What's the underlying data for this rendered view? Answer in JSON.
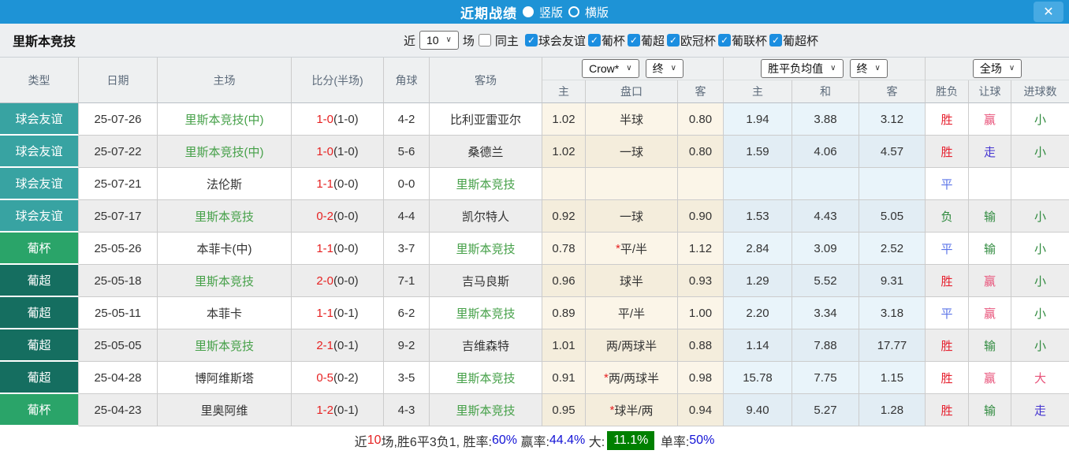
{
  "titlebar": {
    "title": "近期战绩",
    "vertical_label": "竖版",
    "horizontal_label": "横版",
    "close_glyph": "✕"
  },
  "filterbar": {
    "team": "里斯本竞技",
    "near_label": "近",
    "count_value": "10",
    "games_label": "场",
    "same_home_label": "同主",
    "leagues": [
      "球会友谊",
      "葡杯",
      "葡超",
      "欧冠杯",
      "葡联杯",
      "葡超杯"
    ]
  },
  "header": {
    "type": "类型",
    "date": "日期",
    "home": "主场",
    "score": "比分(半场)",
    "corner": "角球",
    "away": "客场",
    "company_select": "Crow*",
    "final_select_1": "终",
    "avg_select": "胜平负均值",
    "final_select_2": "终",
    "scope_select": "全场",
    "sub_home": "主",
    "sub_handicap": "盘口",
    "sub_away": "客",
    "sub_win": "主",
    "sub_draw": "和",
    "sub_lose": "客",
    "sub_result": "胜负",
    "sub_let": "让球",
    "sub_goals": "进球数"
  },
  "rows": [
    {
      "type": "球会友谊",
      "tclass": "friendly",
      "date": "25-07-26",
      "home": "里斯本竞技(中)",
      "home_green": true,
      "score": "1-0",
      "half": "(1-0)",
      "corner": "4-2",
      "away": "比利亚雷亚尔",
      "away_green": false,
      "oh": "1.02",
      "hcap": "半球",
      "star": false,
      "oa": "0.80",
      "w": "1.94",
      "d": "3.88",
      "l": "3.12",
      "res": "胜",
      "res_c": "red",
      "let": "赢",
      "let_c": "rose",
      "goal": "小",
      "goal_c": "green"
    },
    {
      "type": "球会友谊",
      "tclass": "friendly",
      "date": "25-07-22",
      "home": "里斯本竞技(中)",
      "home_green": true,
      "score": "1-0",
      "half": "(1-0)",
      "corner": "5-6",
      "away": "桑德兰",
      "away_green": false,
      "oh": "1.02",
      "hcap": "一球",
      "star": false,
      "oa": "0.80",
      "w": "1.59",
      "d": "4.06",
      "l": "4.57",
      "res": "胜",
      "res_c": "red",
      "let": "走",
      "let_c": "violet",
      "goal": "小",
      "goal_c": "green"
    },
    {
      "type": "球会友谊",
      "tclass": "friendly",
      "date": "25-07-21",
      "home": "法伦斯",
      "home_green": false,
      "score": "1-1",
      "half": "(0-0)",
      "corner": "0-0",
      "away": "里斯本竞技",
      "away_green": true,
      "oh": "",
      "hcap": "",
      "star": false,
      "oa": "",
      "w": "",
      "d": "",
      "l": "",
      "res": "平",
      "res_c": "blue",
      "let": "",
      "let_c": "",
      "goal": "",
      "goal_c": ""
    },
    {
      "type": "球会友谊",
      "tclass": "friendly",
      "date": "25-07-17",
      "home": "里斯本竞技",
      "home_green": true,
      "score": "0-2",
      "half": "(0-0)",
      "corner": "4-4",
      "away": "凯尔特人",
      "away_green": false,
      "oh": "0.92",
      "hcap": "一球",
      "star": false,
      "oa": "0.90",
      "w": "1.53",
      "d": "4.43",
      "l": "5.05",
      "res": "负",
      "res_c": "green",
      "let": "输",
      "let_c": "green",
      "goal": "小",
      "goal_c": "green"
    },
    {
      "type": "葡杯",
      "tclass": "cup",
      "date": "25-05-26",
      "home": "本菲卡(中)",
      "home_green": false,
      "score": "1-1",
      "half": "(0-0)",
      "corner": "3-7",
      "away": "里斯本竞技",
      "away_green": true,
      "oh": "0.78",
      "hcap": "平/半",
      "star": true,
      "oa": "1.12",
      "w": "2.84",
      "d": "3.09",
      "l": "2.52",
      "res": "平",
      "res_c": "blue",
      "let": "输",
      "let_c": "green",
      "goal": "小",
      "goal_c": "green"
    },
    {
      "type": "葡超",
      "tclass": "league",
      "date": "25-05-18",
      "home": "里斯本竞技",
      "home_green": true,
      "score": "2-0",
      "half": "(0-0)",
      "corner": "7-1",
      "away": "吉马良斯",
      "away_green": false,
      "oh": "0.96",
      "hcap": "球半",
      "star": false,
      "oa": "0.93",
      "w": "1.29",
      "d": "5.52",
      "l": "9.31",
      "res": "胜",
      "res_c": "red",
      "let": "赢",
      "let_c": "rose",
      "goal": "小",
      "goal_c": "green"
    },
    {
      "type": "葡超",
      "tclass": "league",
      "date": "25-05-11",
      "home": "本菲卡",
      "home_green": false,
      "score": "1-1",
      "half": "(0-1)",
      "corner": "6-2",
      "away": "里斯本竞技",
      "away_green": true,
      "oh": "0.89",
      "hcap": "平/半",
      "star": false,
      "oa": "1.00",
      "w": "2.20",
      "d": "3.34",
      "l": "3.18",
      "res": "平",
      "res_c": "blue",
      "let": "赢",
      "let_c": "rose",
      "goal": "小",
      "goal_c": "green"
    },
    {
      "type": "葡超",
      "tclass": "league",
      "date": "25-05-05",
      "home": "里斯本竞技",
      "home_green": true,
      "score": "2-1",
      "half": "(0-1)",
      "corner": "9-2",
      "away": "吉维森特",
      "away_green": false,
      "oh": "1.01",
      "hcap": "两/两球半",
      "star": false,
      "oa": "0.88",
      "w": "1.14",
      "d": "7.88",
      "l": "17.77",
      "res": "胜",
      "res_c": "red",
      "let": "输",
      "let_c": "green",
      "goal": "小",
      "goal_c": "green"
    },
    {
      "type": "葡超",
      "tclass": "league",
      "date": "25-04-28",
      "home": "博阿维斯塔",
      "home_green": false,
      "score": "0-5",
      "half": "(0-2)",
      "corner": "3-5",
      "away": "里斯本竞技",
      "away_green": true,
      "oh": "0.91",
      "hcap": "两/两球半",
      "star": true,
      "oa": "0.98",
      "w": "15.78",
      "d": "7.75",
      "l": "1.15",
      "res": "胜",
      "res_c": "red",
      "let": "赢",
      "let_c": "rose",
      "goal": "大",
      "goal_c": "rose"
    },
    {
      "type": "葡杯",
      "tclass": "cup",
      "date": "25-04-23",
      "home": "里奥阿维",
      "home_green": false,
      "score": "1-2",
      "half": "(0-1)",
      "corner": "4-3",
      "away": "里斯本竞技",
      "away_green": true,
      "oh": "0.95",
      "hcap": "球半/两",
      "star": true,
      "oa": "0.94",
      "w": "9.40",
      "d": "5.27",
      "l": "1.28",
      "res": "胜",
      "res_c": "red",
      "let": "输",
      "let_c": "green",
      "goal": "走",
      "goal_c": "violet"
    }
  ],
  "footer": {
    "segments": [
      {
        "text": "近",
        "style": "dark"
      },
      {
        "text": "10",
        "style": "red"
      },
      {
        "text": "场,胜6平3负1, 胜率:",
        "style": "dark"
      },
      {
        "text": "60%",
        "style": "blue"
      },
      {
        "text": " 赢率:",
        "style": "dark"
      },
      {
        "text": "44.4%",
        "style": "blue"
      },
      {
        "text": " 大:",
        "style": "dark"
      },
      {
        "text": "11.1%",
        "style": "greenbox"
      },
      {
        "text": " 单率:",
        "style": "dark"
      },
      {
        "text": "50%",
        "style": "blue"
      }
    ]
  },
  "colors": {
    "accent_blue": "#1e93d6",
    "type_friendly": "#38a3a2",
    "type_cup": "#2aa469",
    "type_league": "#156e60",
    "team_green": "#45a048",
    "score_red": "#e62222",
    "win_red": "#e62230",
    "handicap_rose": "#e8537a",
    "lose_green": "#2f8a3e",
    "draw_blue": "#5b74e8",
    "push_violet": "#4434d0",
    "summary_green_bg": "#008000",
    "percent_blue": "#1313d6"
  }
}
